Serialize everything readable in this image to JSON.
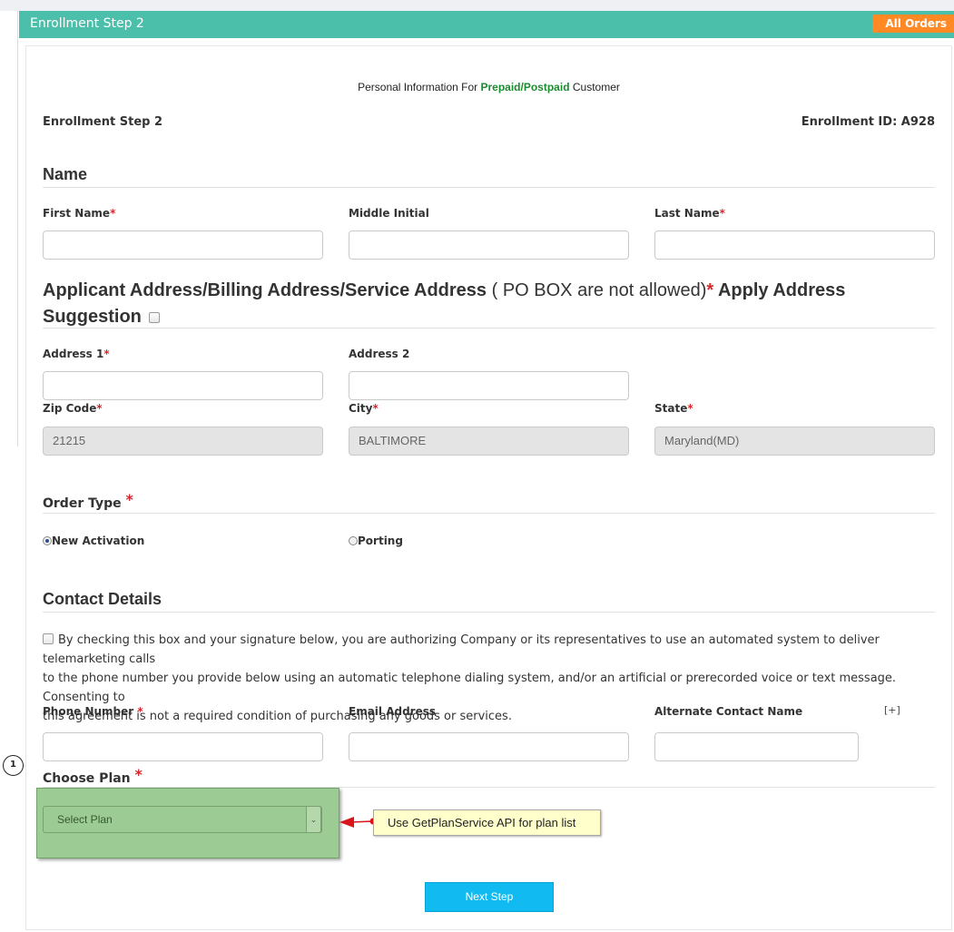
{
  "header": {
    "title": "Enrollment Step 2",
    "all_orders": "All Orders"
  },
  "intro": {
    "prefix": "Personal Information For ",
    "highlight": "Prepaid/Postpaid",
    "suffix": " Customer"
  },
  "step_label": "Enrollment Step 2",
  "enrollment_id": "Enrollment ID: A928",
  "name_section": {
    "heading": "Name",
    "first_name_label": "First Name",
    "middle_initial_label": "Middle Initial",
    "last_name_label": "Last Name"
  },
  "address_section": {
    "heading": "Applicant Address/Billing Address/Service Address",
    "note": " ( PO BOX are not allowed)",
    "suggestion_part1": " Apply Address",
    "suggestion_part2": "Suggestion",
    "address1_label": "Address 1",
    "address2_label": "Address 2",
    "zip_label": "Zip Code",
    "zip_value": "21215",
    "city_label": "City",
    "city_value": "BALTIMORE",
    "state_label": "State",
    "state_value": "Maryland(MD)"
  },
  "order_type": {
    "heading": "Order Type",
    "option_new": "New Activation",
    "option_porting": "Porting",
    "selected": "New Activation"
  },
  "contact": {
    "heading": "Contact Details",
    "consent_line1": "By checking this box and your signature below, you are authorizing Company or its representatives to use an automated system to deliver telemarketing calls",
    "consent_line2": "to the phone number you provide below using an automatic telephone dialing system, and/or an artificial or prerecorded voice or text message. Consenting to",
    "consent_line3": "this agreement is not a required condition of purchasing any goods or services.",
    "phone_label": "Phone Number",
    "email_label": "Email Address",
    "alt_contact_label": "Alternate Contact Name",
    "add_more": "[+]"
  },
  "plan": {
    "heading": "Choose Plan",
    "select_placeholder": "Select Plan",
    "callout": "Use GetPlanService API for plan list",
    "marker_number": "1"
  },
  "required_mark": "*",
  "next_button": "Next Step",
  "colors": {
    "header_bg": "#4cbfab",
    "all_orders_bg": "#ff8a25",
    "prepaid_green": "#1a8c2e",
    "required_red": "#d9262c",
    "next_button_bg": "#11baf1",
    "annotation_green": "#9ccc93",
    "callout_yellow": "#ffffcc"
  }
}
